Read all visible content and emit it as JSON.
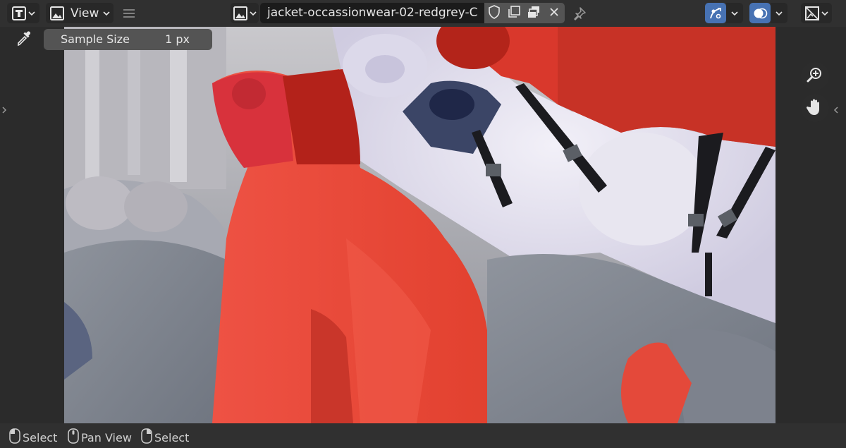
{
  "header": {
    "editor_type_icon": "image-editor-icon",
    "view_mode_icon": "image-mode-icon",
    "view_menu_label": "View",
    "menu_icon": "hamburger-menu-icon",
    "image_browse_icon": "image-browse-icon",
    "image_name": "jacket-occassionwear-02-redgrey-C",
    "image_actions": [
      "fake-user-shield-icon",
      "duplicate-icon",
      "new-image-icon",
      "close-icon"
    ],
    "pin_icon": "pin-icon",
    "gizmo_icon": "gizmo-icon",
    "overlay_icon": "overlay-icon",
    "display_channels_icon": "display-channels-icon"
  },
  "tool": {
    "icon": "eyedropper-icon",
    "sample_size_label": "Sample Size",
    "sample_size_value": "1 px"
  },
  "viewport": {
    "left_toggle_icon": "chevron-right-icon",
    "right_toggle_icon": "chevron-left-icon",
    "nav_buttons": [
      "zoom-icon",
      "hand-pan-icon"
    ]
  },
  "statusbar": {
    "items": [
      {
        "icon": "mouse-left-icon",
        "label": "Select"
      },
      {
        "icon": "mouse-middle-icon",
        "label": "Pan View"
      },
      {
        "icon": "mouse-right-icon",
        "label": "Select"
      }
    ]
  },
  "colors": {
    "accent": "#4772b3",
    "fabric_red": "#e8483a",
    "fabric_grey": "#8a8f99",
    "fabric_white": "#e4e2ef"
  }
}
